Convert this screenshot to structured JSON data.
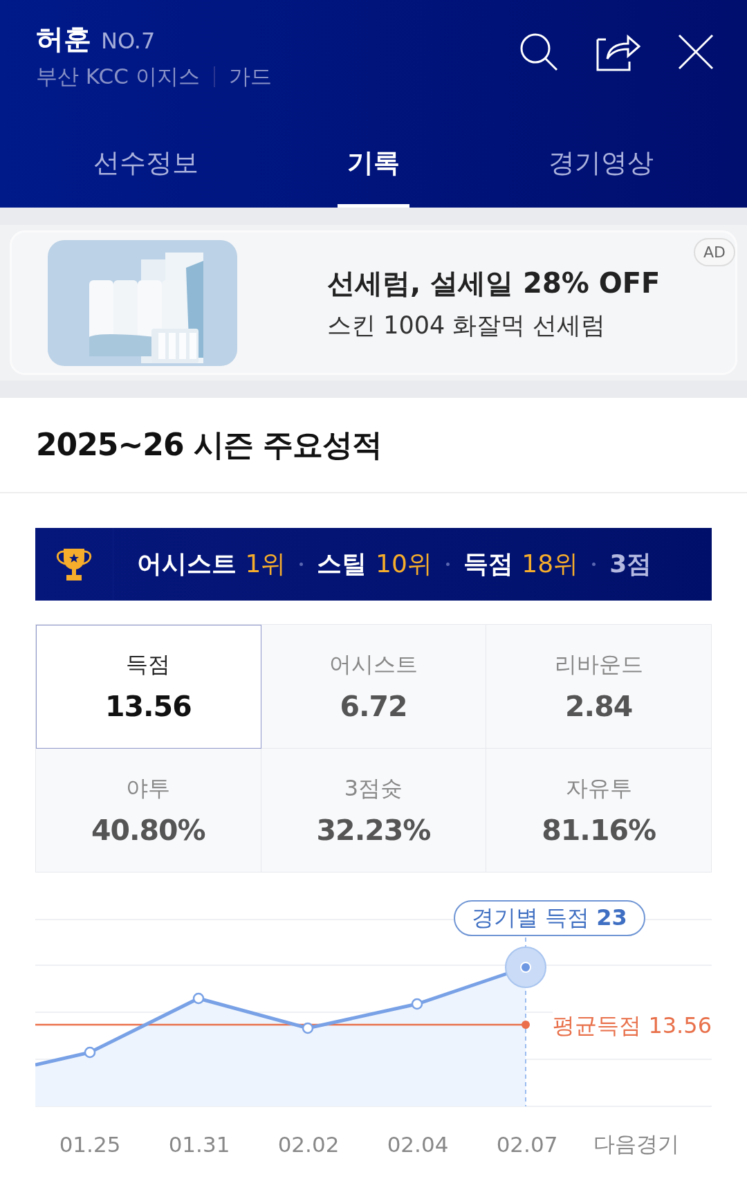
{
  "header": {
    "name": "허훈",
    "number": "NO.7",
    "team": "부산 KCC 이지스",
    "position": "가드"
  },
  "tabs": [
    {
      "label": "선수정보",
      "selected": false
    },
    {
      "label": "기록",
      "selected": true
    },
    {
      "label": "경기영상",
      "selected": false
    }
  ],
  "ad": {
    "kind": "picture",
    "headline": "선세럼, 설세일 28% OFF",
    "subline": "스킨 1004 화잘먹 선세럼",
    "badge": "AD"
  },
  "section_title": "2025~26 시즌 주요성적",
  "rankings": [
    {
      "stat": "어시스트",
      "rank": "1위"
    },
    {
      "stat": "스틸",
      "rank": "10위"
    },
    {
      "stat": "득점",
      "rank": "18위"
    },
    {
      "stat": "3점"
    }
  ],
  "stats": [
    {
      "label": "득점",
      "value": "13.56",
      "selected": true
    },
    {
      "label": "어시스트",
      "value": "6.72",
      "selected": false
    },
    {
      "label": "리바운드",
      "value": "2.84",
      "selected": false
    },
    {
      "label": "야투",
      "value": "40.80%",
      "selected": false
    },
    {
      "label": "3점슛",
      "value": "32.23%",
      "selected": false
    },
    {
      "label": "자유투",
      "value": "81.16%",
      "selected": false
    }
  ],
  "chart": {
    "tooltip": "경기별 득점 **23**",
    "average_label": "평균득점 13.56",
    "x_labels": [
      "01.25",
      "01.31",
      "02.02",
      "02.04",
      "02.07",
      "다음경기"
    ]
  }
}
